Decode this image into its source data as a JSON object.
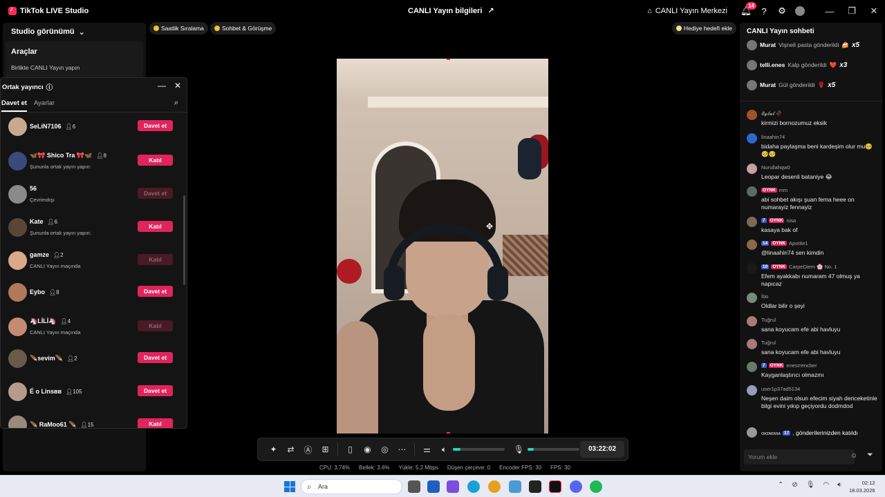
{
  "app": {
    "title": "TikTok LIVE Studio",
    "center_title": "CANLI Yayın bilgileri",
    "live_center": "CANLI Yayın Merkezi",
    "notif_count": "14"
  },
  "left": {
    "studio_view": "Studio görünümü",
    "tools_title": "Araçlar",
    "tools_sub": "Birlikte CANLI Yayın yapın"
  },
  "cohost": {
    "title": "Ortak yayıncı",
    "tab_invite": "Davet et",
    "tab_settings": "Ayarlar",
    "rows": [
      {
        "name": "SeLiN7106",
        "count": "6",
        "status": "",
        "btn": "Davet et",
        "dim": false,
        "color": "#c9a890"
      },
      {
        "name": "🦋🎀 Shico Tra 🎀🦋",
        "count": "8",
        "status": "Şununla ortak yayın yapın:",
        "btn": "Katıl",
        "dim": false,
        "color": "#3a4a7a"
      },
      {
        "name": "56",
        "count": "",
        "status": "Çevrimdışı",
        "btn": "Davet et",
        "dim": true,
        "color": "#8a8a8a"
      },
      {
        "name": "Kate",
        "count": "6",
        "status": "Şununla ortak yayın yapın:",
        "btn": "Katıl",
        "dim": false,
        "color": "#5a4636"
      },
      {
        "name": "gamze",
        "count": "2",
        "status": "CANLI Yayın maçında",
        "btn": "Katıl",
        "dim": true,
        "color": "#d9a98a"
      },
      {
        "name": "Eybo",
        "count": "8",
        "status": "",
        "btn": "Davet et",
        "dim": false,
        "color": "#b07a5a"
      },
      {
        "name": "🦄LİLİ🦄",
        "count": "4",
        "status": "CANLI Yayın maçında",
        "btn": "Katıl",
        "dim": true,
        "color": "#c48a74"
      },
      {
        "name": "🪶sevim🪶",
        "count": "2",
        "status": "",
        "btn": "Davet et",
        "dim": false,
        "color": "#6a5a4a"
      },
      {
        "name": "É o Linsвв",
        "count": "105",
        "status": "",
        "btn": "Davet et",
        "dim": false,
        "color": "#b89a8a"
      },
      {
        "name": "🪶 RaMoo61 🪶",
        "count": "15",
        "status": "",
        "btn": "Katıl",
        "dim": false,
        "color": "#9a8a7a"
      }
    ]
  },
  "pills": {
    "hourly": "Saatlik Sıralama",
    "chat_call": "Sohbet & Görüşme",
    "gift_goal": "Hediye hedefi ekle"
  },
  "toolbar": {
    "timer": "03:22:02",
    "volume_level": 0.15,
    "mic_level": 0.12
  },
  "stats": {
    "cpu": "CPU:  3.74%",
    "memory": "Bellek:  3.6%",
    "upload": "Yükle:  5.2 Mbps",
    "dropped": "Düşen çerçeve:  0",
    "encoder_fps": "Encoder FPS:  30",
    "fps": "FPS:  30"
  },
  "chat": {
    "title": "CANLI Yayın sohbeti",
    "gifts": [
      {
        "user": "Murat",
        "text": "Vişneli pasta gönderildi",
        "icon": "🍰",
        "mult": "x5"
      },
      {
        "user": "telli.enes",
        "text": "Kalp gönderildi",
        "icon": "❤️",
        "mult": "x3"
      },
      {
        "user": "Murat",
        "text": "Gül gönderildi",
        "icon": "🌹",
        "mult": "x5"
      }
    ],
    "messages": [
      {
        "name": "𝓔𝔂𝓵𝓾𝓵 🥀",
        "lvl": "",
        "fan": "",
        "text": "kirmizi bornozumuz eksik",
        "color": "#a0522d"
      },
      {
        "name": "linaahin74",
        "lvl": "",
        "fan": "",
        "text": "bidaha paylaşma beni kardeşim olur mu🥺🥺🥺",
        "color": "#2a6ad0"
      },
      {
        "name": "Nurullahqw0",
        "lvl": "",
        "fan": "",
        "text": "Leopar desenli bataniye 😂",
        "color": "#c9a0a0"
      },
      {
        "name": "mm",
        "lvl": "",
        "fan": "OYNK",
        "text": "abi sohbet akışı şuan fema heee on numarayiz fennayiz",
        "color": "#5a6a6a"
      },
      {
        "name": "nisa",
        "lvl": "7",
        "fan": "OYNK",
        "text": "kasaya bak of",
        "color": "#7a6a5a"
      },
      {
        "name": "Apotite1",
        "lvl": "14",
        "fan": "OYNK",
        "text": "@linaahin74 sen kimdin",
        "color": "#8a6a4a"
      },
      {
        "name": "CarpeDiem 🌸 No. 1",
        "lvl": "10",
        "fan": "OYNK",
        "text": "Efem ayakkabı numaram 47 olmuş ya napıcaz",
        "color": "#1a1a1a"
      },
      {
        "name": "İbo",
        "lvl": "",
        "fan": "",
        "text": "Oldlar bilir o şeyi",
        "color": "#7a8a7a"
      },
      {
        "name": "Tuğrul",
        "lvl": "",
        "fan": "",
        "text": "sana koyucam efe abi havluyu",
        "color": "#aa7a7a"
      },
      {
        "name": "Tuğrul",
        "lvl": "",
        "fan": "",
        "text": "sana koyucam efe abi havluyu",
        "color": "#aa7a7a"
      },
      {
        "name": "enesrrencber",
        "lvl": "7",
        "fan": "OYNK",
        "text": "Kayganlaştırıcı olmazmı",
        "color": "#6a7a6a"
      },
      {
        "name": "user1p37ad5134",
        "lvl": "",
        "fan": "",
        "text": "Neşen daim olsun efecim siyah dericeketinle bilgi evini yıkıp geçiyordu dodmdod",
        "color": "#9a9aba"
      }
    ],
    "join_user": "ᴏᴋɪɴᴏᴡᴀ",
    "join_lvl": "17",
    "join_text": ", gönderilerinizden katıldı",
    "input_placeholder": "Yorum ekle"
  },
  "taskbar": {
    "search_placeholder": "Ara",
    "time": "02:12",
    "date": "18.03.2026"
  }
}
